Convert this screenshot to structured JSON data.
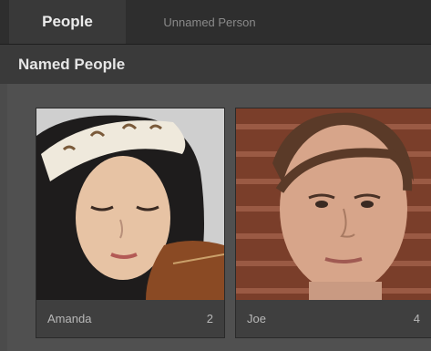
{
  "tabs": [
    {
      "label": "People",
      "active": true
    },
    {
      "label": "Unnamed Person",
      "active": false
    }
  ],
  "section": {
    "title": "Named People"
  },
  "people": [
    {
      "name": "Amanda",
      "count": "2"
    },
    {
      "name": "Joe",
      "count": "4"
    }
  ],
  "colors": {
    "tabbar_bg": "#2e2e2e",
    "active_tab_bg": "#393939",
    "header_bg": "#3a3a3a",
    "panel_bg": "#505050",
    "caption_bg": "#3f3f3f"
  }
}
